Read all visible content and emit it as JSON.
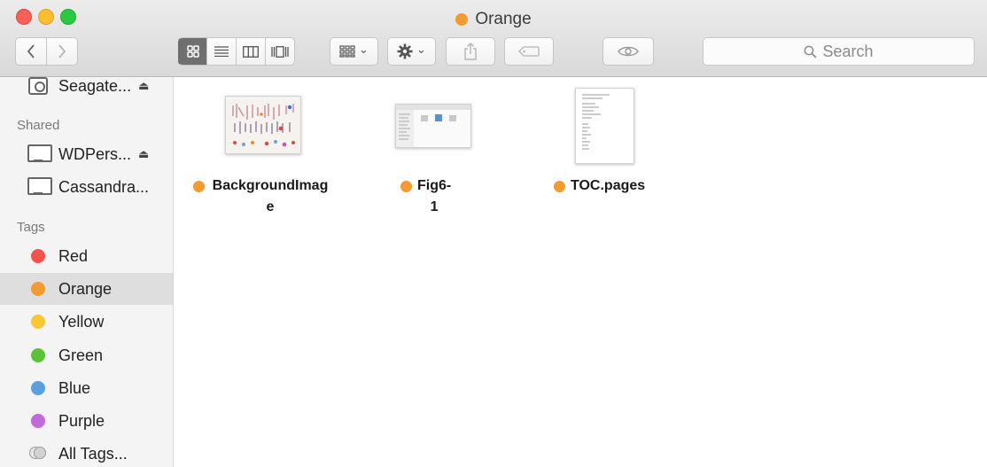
{
  "window": {
    "title": "Orange",
    "title_tag_color": "#f39a30",
    "traffic_lights": {
      "close": "#fc5f57",
      "minimize": "#fdbd2e",
      "maximize": "#2ac941"
    }
  },
  "toolbar": {
    "back_icon": "chevron-left",
    "forward_icon": "chevron-right",
    "view_modes": [
      "icon-view",
      "list-view",
      "column-view",
      "cover-flow-view"
    ],
    "selected_view": "icon-view",
    "group_icon": "arrange-grid",
    "action_icon": "gear",
    "share_icon": "share",
    "tags_icon": "tag",
    "quicklook_icon": "eye",
    "search_placeholder": "Search",
    "search_icon": "magnifier",
    "dropdown_glyph": "⌄"
  },
  "sidebar": {
    "devices": [
      {
        "label": "Seagate...",
        "icon": "hdd-icon",
        "eject": "⏏"
      }
    ],
    "shared_heading": "Shared",
    "shared": [
      {
        "label": "WDPers...",
        "icon": "monitor-icon",
        "eject": "⏏"
      },
      {
        "label": "Cassandra...",
        "icon": "monitor-icon"
      }
    ],
    "tags_heading": "Tags",
    "tags": [
      {
        "label": "Red",
        "color": "#f2544d"
      },
      {
        "label": "Orange",
        "color": "#f39a30",
        "selected": true
      },
      {
        "label": "Yellow",
        "color": "#f8c636"
      },
      {
        "label": "Green",
        "color": "#5bc236"
      },
      {
        "label": "Blue",
        "color": "#5a9fdf"
      },
      {
        "label": "Purple",
        "color": "#c06bd9"
      }
    ],
    "all_tags_label": "All Tags..."
  },
  "files": [
    {
      "name": "BackgroundImage",
      "tag_color": "#f39a30"
    },
    {
      "name": "Fig6-1",
      "tag_color": "#f39a30"
    },
    {
      "name": "TOC.pages",
      "tag_color": "#f39a30"
    }
  ]
}
